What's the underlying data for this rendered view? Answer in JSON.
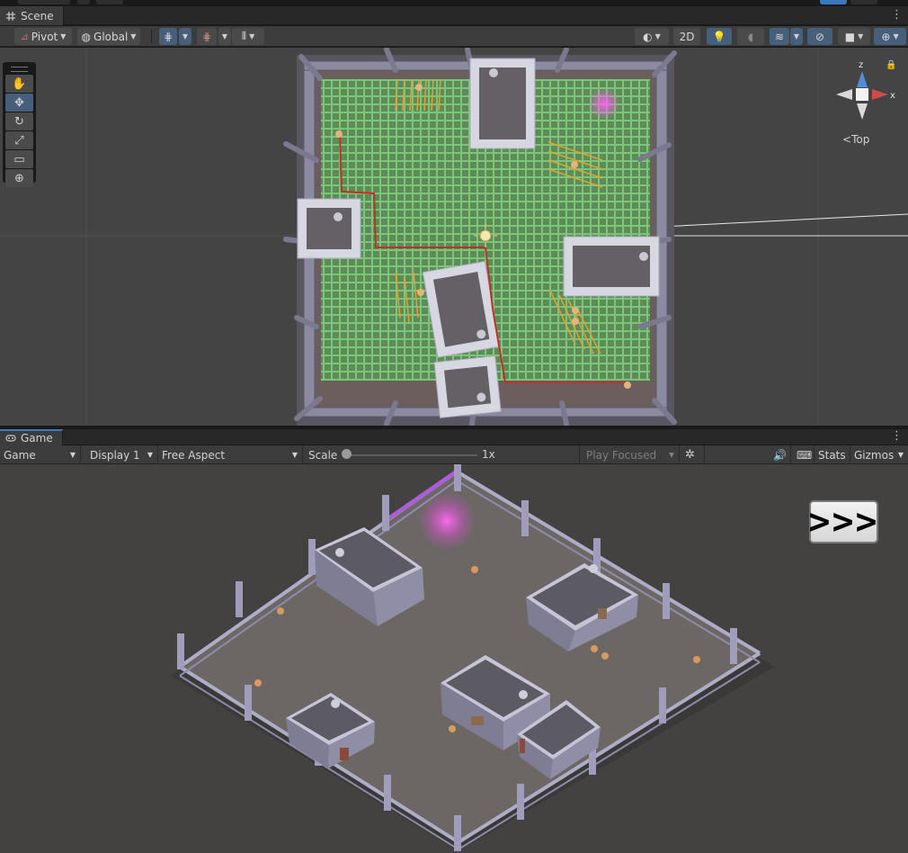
{
  "scene_tab": {
    "label": "Scene"
  },
  "scene_toolbar": {
    "pivot": "Pivot",
    "global": "Global",
    "mode_2d": "2D"
  },
  "gizmo": {
    "view_label": "Top",
    "axis_x": "x",
    "axis_z": "z"
  },
  "game_tab": {
    "label": "Game"
  },
  "game_toolbar": {
    "view_select": "Game",
    "display": "Display 1",
    "aspect": "Free Aspect",
    "scale_label": "Scale",
    "scale_value": "1x",
    "play_mode": "Play Focused",
    "stats": "Stats",
    "gizmos": "Gizmos"
  },
  "game_view": {
    "skip_button": ">>>"
  },
  "colors": {
    "accent_blue": "#46607c",
    "nav_grid_green": "#63a05d",
    "path_red": "#c0302b",
    "magic_pink": "#ff4fd8"
  }
}
